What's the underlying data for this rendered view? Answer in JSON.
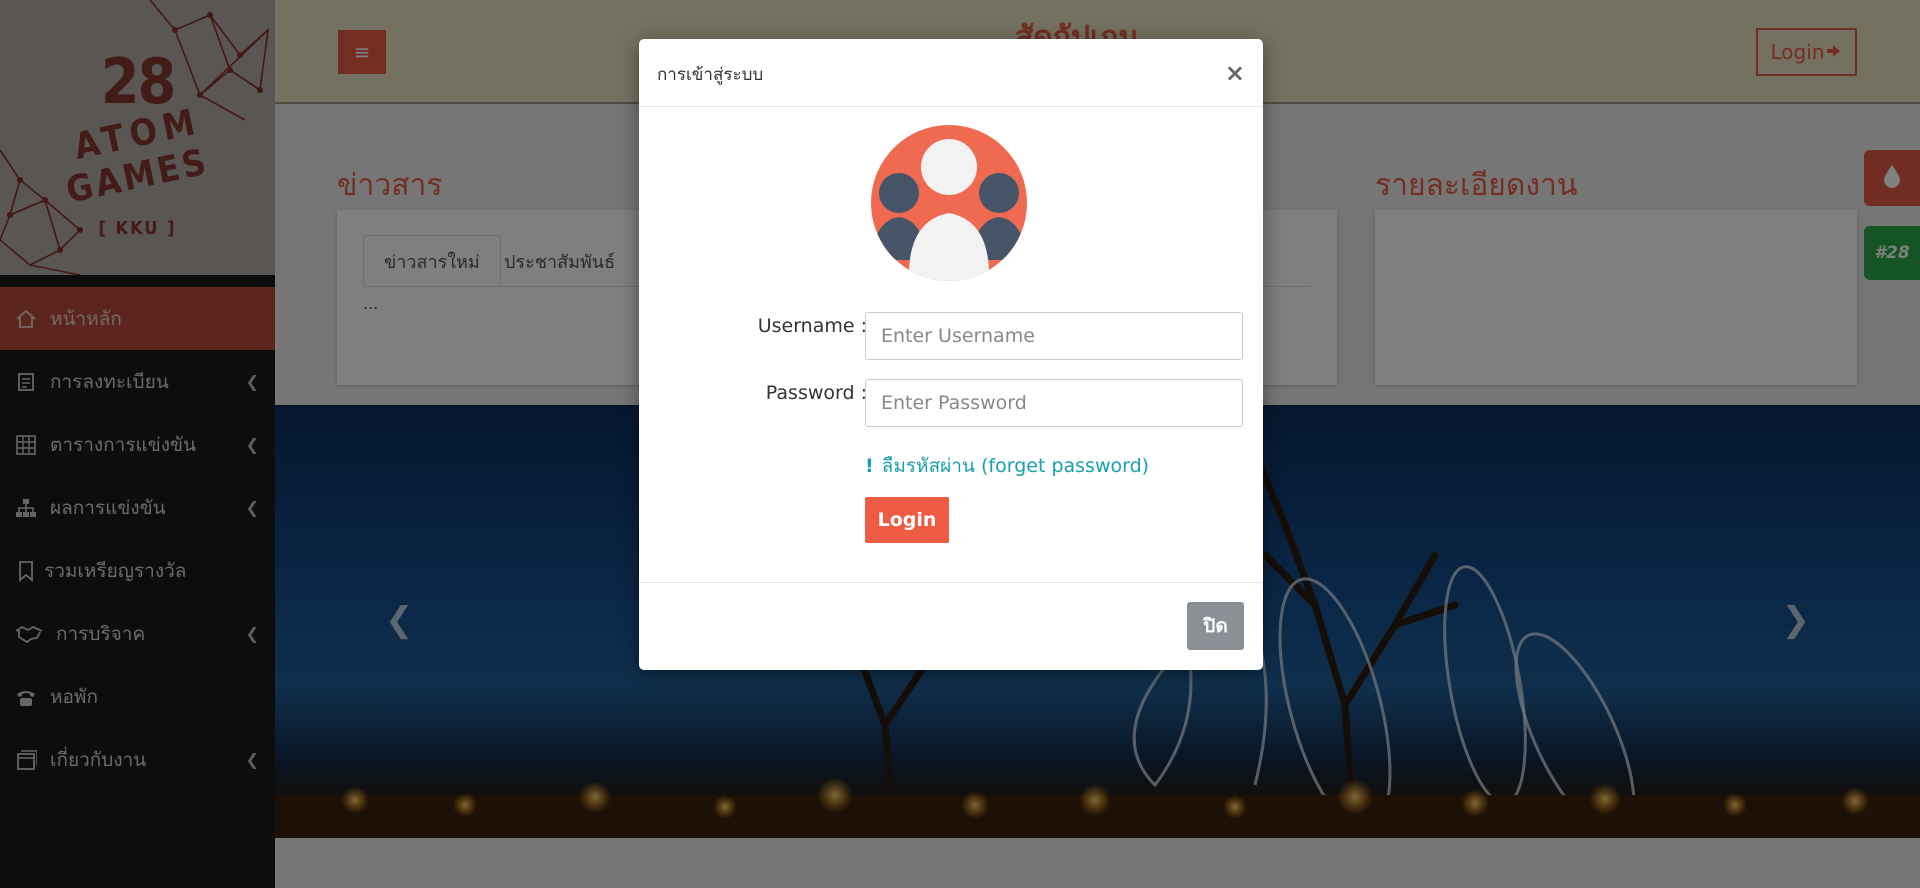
{
  "logo": {
    "number": "28",
    "line1": "ATOM",
    "line2": "GAMES",
    "line3": "[ KKU ]"
  },
  "sidebar": {
    "items": [
      {
        "label": "หน้าหลัก",
        "icon": "home-icon",
        "active": true,
        "has_submenu": false
      },
      {
        "label": "การลงทะเบียน",
        "icon": "register-icon",
        "active": false,
        "has_submenu": true
      },
      {
        "label": "ตารางการแข่งขัน",
        "icon": "table-icon",
        "active": false,
        "has_submenu": true
      },
      {
        "label": "ผลการแข่งขัน",
        "icon": "sitemap-icon",
        "active": false,
        "has_submenu": true
      },
      {
        "label": "รวมเหรียญรางวัล",
        "icon": "bookmark-icon",
        "active": false,
        "has_submenu": false
      },
      {
        "label": "การบริจาค",
        "icon": "handshake-icon",
        "active": false,
        "has_submenu": true
      },
      {
        "label": "หอพัก",
        "icon": "phone-icon",
        "active": false,
        "has_submenu": false
      },
      {
        "label": "เกี่ยวกับงาน",
        "icon": "window-icon",
        "active": false,
        "has_submenu": true
      }
    ]
  },
  "topbar": {
    "menu_icon": "hamburger-icon",
    "title": "สัดกัปเกม",
    "login_label": "Login"
  },
  "news": {
    "title": "ข่าวสาร",
    "tabs": [
      "ข่าวสารใหม่",
      "ประชาสัมพันธ์"
    ],
    "content": "..."
  },
  "details": {
    "title": "รายละเอียดงาน"
  },
  "side_buttons": {
    "blood_icon": "drop-icon",
    "tag_label": "#28"
  },
  "modal": {
    "title": "การเข้าสู่ระบบ",
    "close_symbol": "×",
    "avatar_icon": "users-icon",
    "username_label": "Username :",
    "username_placeholder": "Enter Username",
    "password_label": "Password :",
    "password_placeholder": "Enter Password",
    "forget_mark": "!",
    "forget_label": "ลืมรหัสผ่าน (forget password)",
    "login_label": "Login",
    "close_label": "ปิด"
  },
  "colors": {
    "accent": "#ee5b43",
    "link": "#19a0b0",
    "sidebar_bg": "#1d1b1b",
    "topbar_bg": "#e9e3c2",
    "green": "#2aa84a"
  }
}
